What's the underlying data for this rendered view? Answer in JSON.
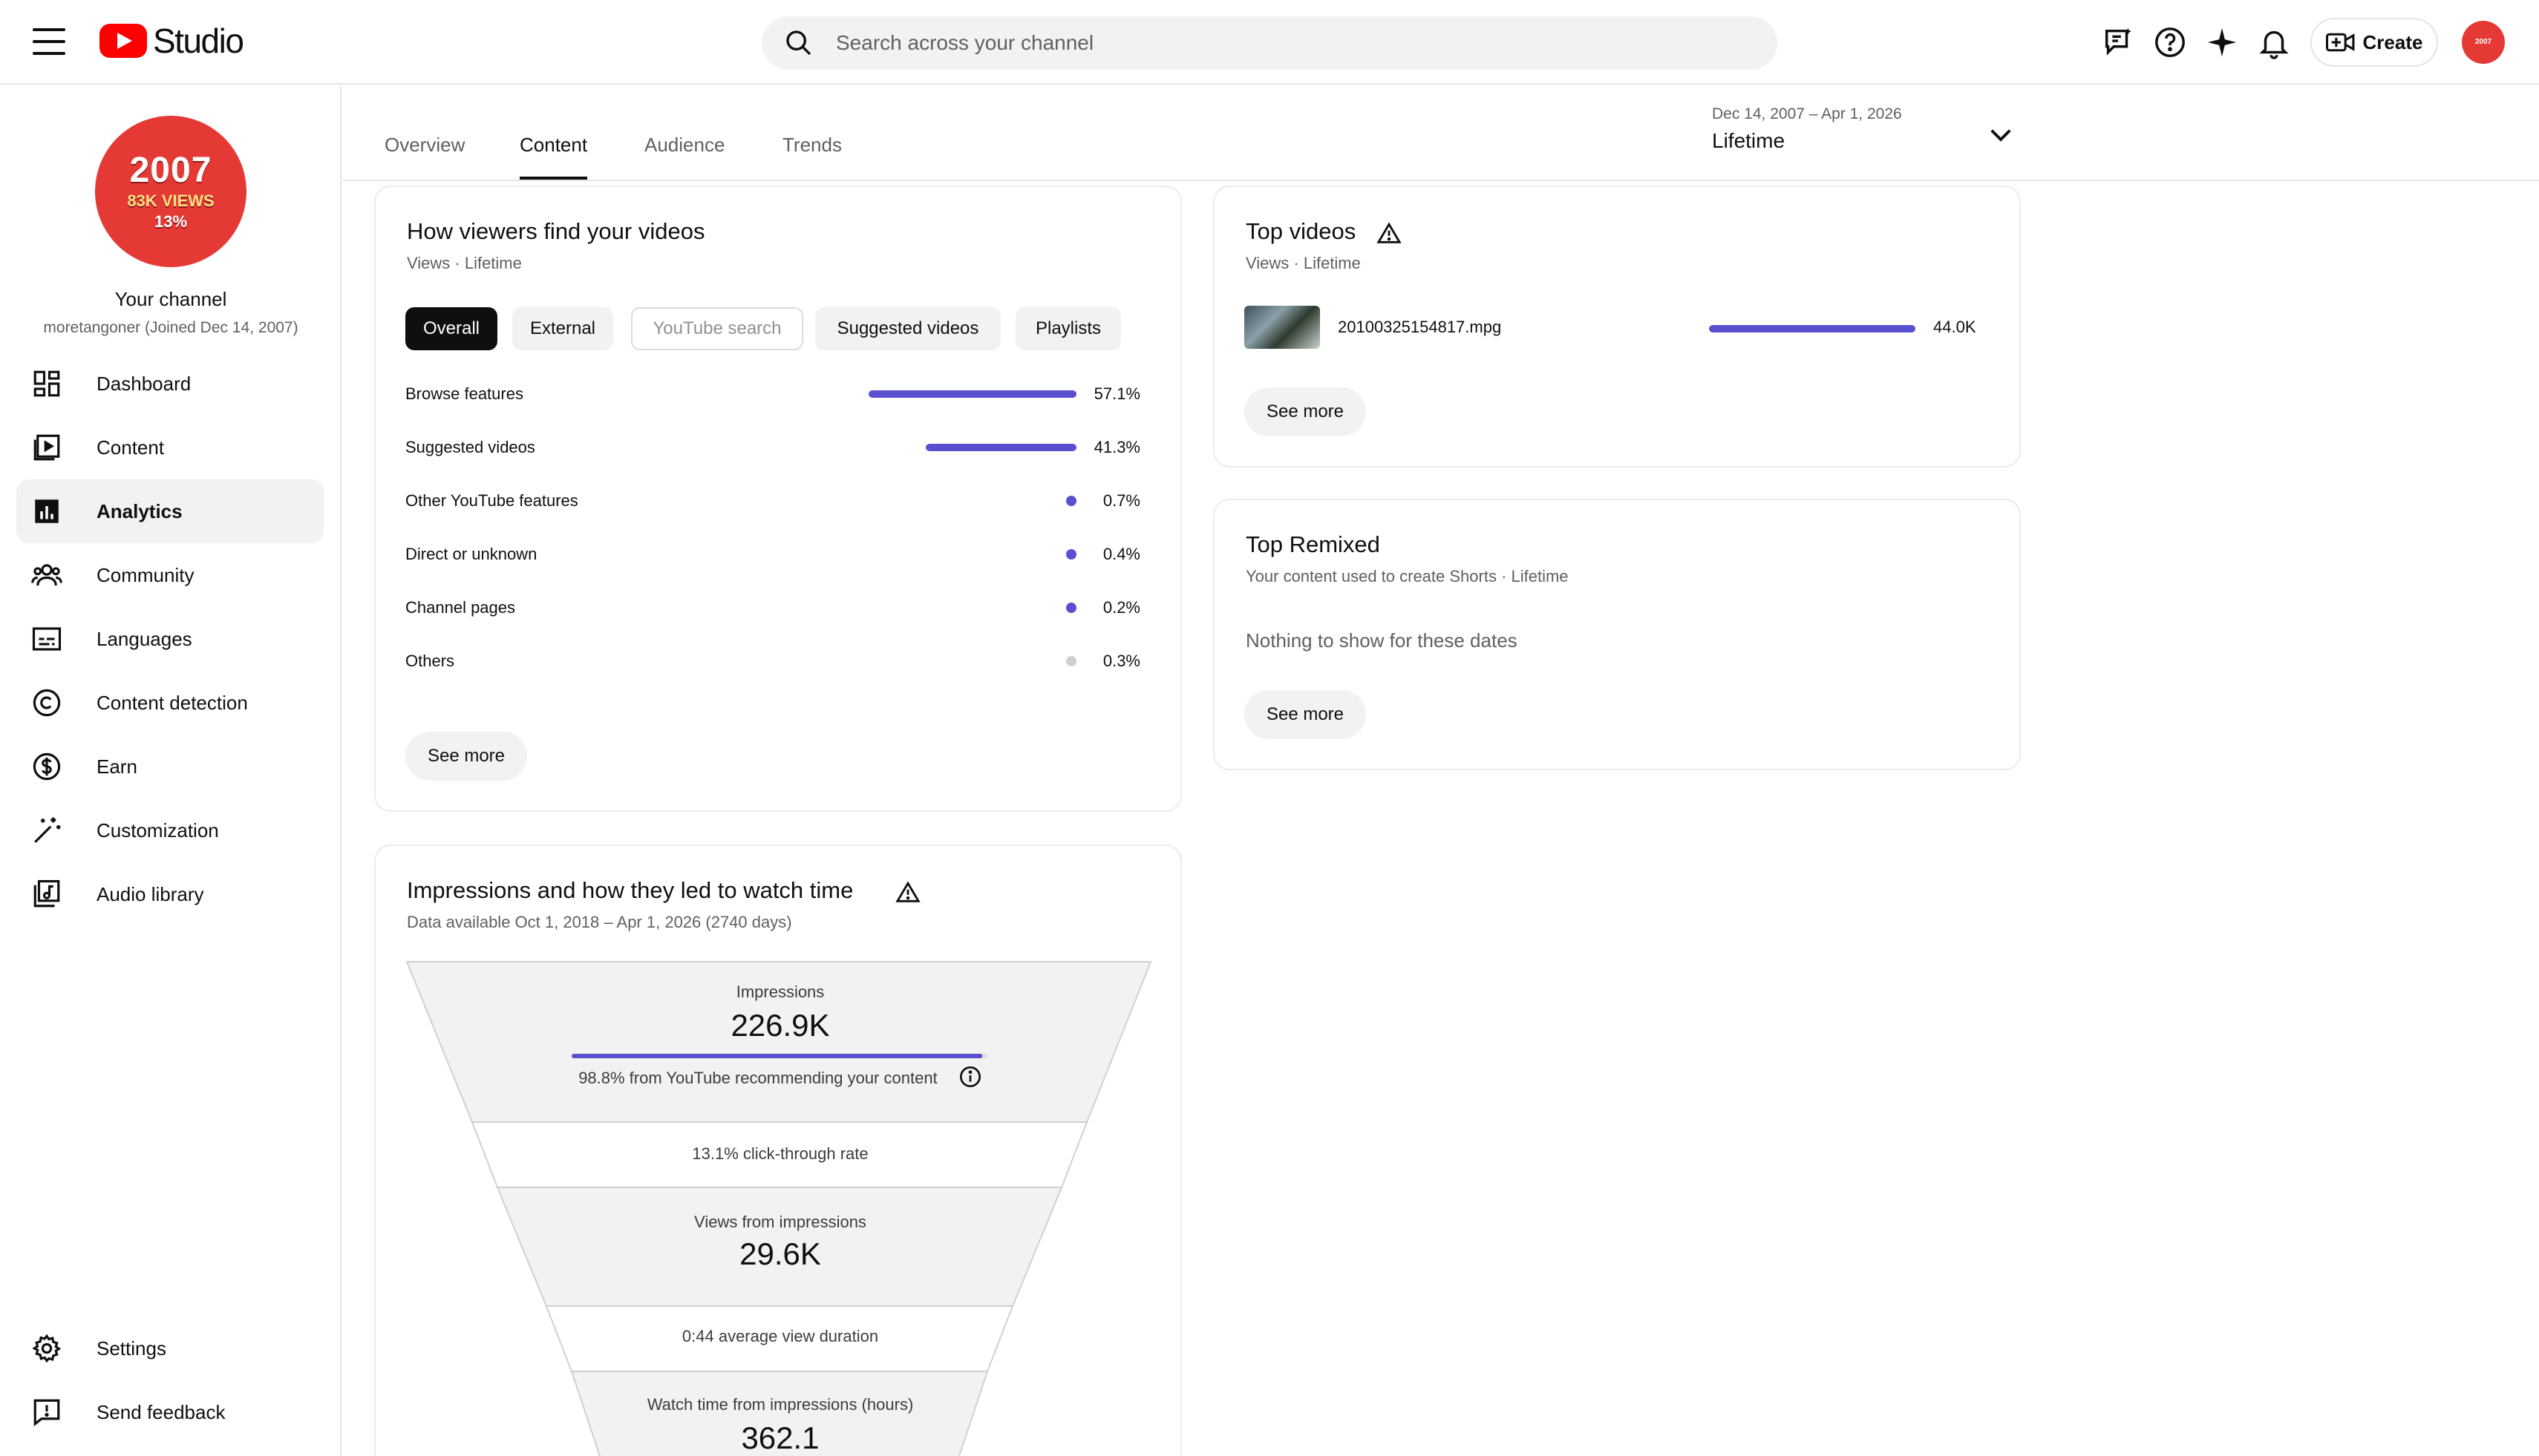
{
  "header": {
    "logo_text": "Studio",
    "search_placeholder": "Search across your channel",
    "create_label": "Create",
    "avatar_text": "2007"
  },
  "channel": {
    "avatar_year": "2007",
    "avatar_views": "83K VIEWS",
    "avatar_pct": "13%",
    "name": "Your channel",
    "sub": "moretangoner (Joined Dec 14, 2007)"
  },
  "nav": {
    "items": [
      {
        "label": "Dashboard",
        "icon": "dashboard-icon"
      },
      {
        "label": "Content",
        "icon": "content-icon"
      },
      {
        "label": "Analytics",
        "icon": "analytics-icon"
      },
      {
        "label": "Community",
        "icon": "community-icon"
      },
      {
        "label": "Languages",
        "icon": "subtitles-icon"
      },
      {
        "label": "Content detection",
        "icon": "copyright-icon"
      },
      {
        "label": "Earn",
        "icon": "dollar-icon"
      },
      {
        "label": "Customization",
        "icon": "magic-wand-icon"
      },
      {
        "label": "Audio library",
        "icon": "audio-library-icon"
      }
    ],
    "settings_label": "Settings",
    "feedback_label": "Send feedback"
  },
  "tabs": [
    "Overview",
    "Content",
    "Audience",
    "Trends"
  ],
  "date": {
    "range": "Dec 14, 2007 – Apr 1, 2026",
    "label": "Lifetime"
  },
  "traffic": {
    "title": "How viewers find your videos",
    "sub": "Views · Lifetime",
    "chips": [
      "Overall",
      "External",
      "YouTube search",
      "Suggested videos",
      "Playlists"
    ],
    "rows": [
      {
        "label": "Browse features",
        "pct": "57.1%",
        "value": 57.1
      },
      {
        "label": "Suggested videos",
        "pct": "41.3%",
        "value": 41.3
      },
      {
        "label": "Other YouTube features",
        "pct": "0.7%",
        "value": 0.7
      },
      {
        "label": "Direct or unknown",
        "pct": "0.4%",
        "value": 0.4
      },
      {
        "label": "Channel pages",
        "pct": "0.2%",
        "value": 0.2
      },
      {
        "label": "Others",
        "pct": "0.3%",
        "value": 0.3
      }
    ],
    "see_more": "See more"
  },
  "impressions": {
    "title": "Impressions and how they led to watch time",
    "sub": "Data available Oct 1, 2018 – Apr 1, 2026 (2740 days)",
    "impressions_label": "Impressions",
    "impressions_value": "226.9K",
    "recommending": "98.8% from YouTube recommending your content",
    "recommending_value": 98.8,
    "ctr": "13.1% click-through rate",
    "views_label": "Views from impressions",
    "views_value": "29.6K",
    "avd": "0:44 average view duration",
    "watch_label": "Watch time from impressions (hours)",
    "watch_value": "362.1"
  },
  "top_videos": {
    "title": "Top videos",
    "sub": "Views · Lifetime",
    "video_title": "20100325154817.mpg",
    "video_views": "44.0K",
    "see_more": "See more"
  },
  "top_remixed": {
    "title": "Top Remixed",
    "sub": "Your content used to create Shorts · Lifetime",
    "empty": "Nothing to show for these dates",
    "see_more": "See more"
  }
}
